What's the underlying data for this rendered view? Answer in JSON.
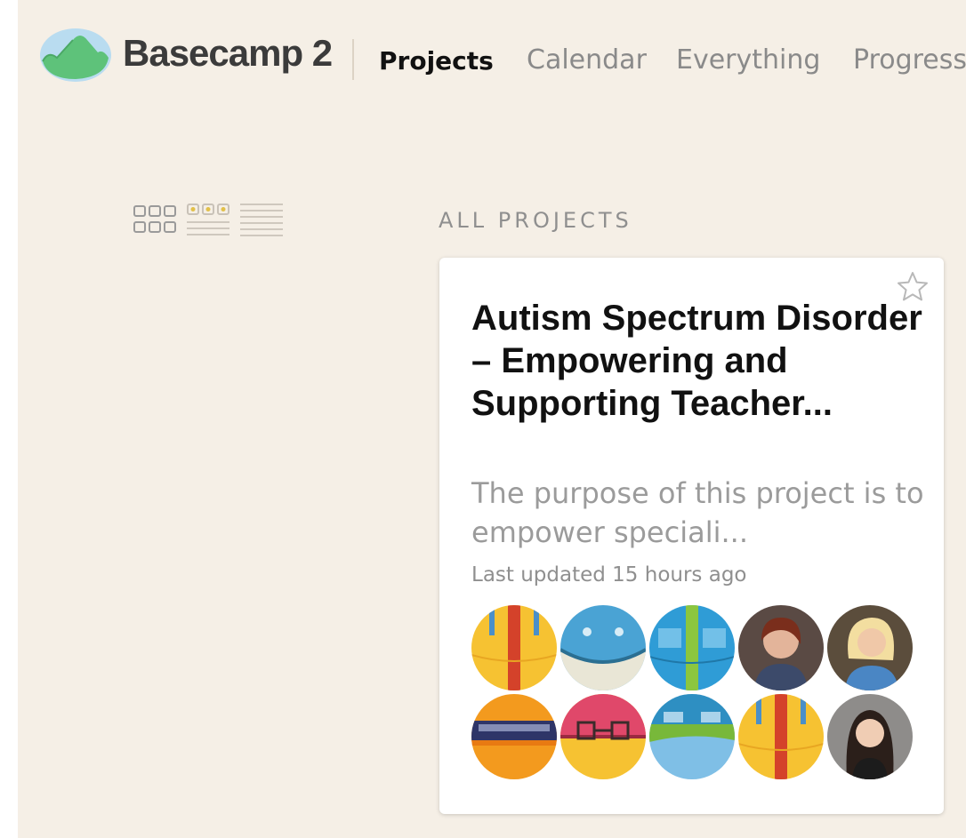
{
  "header": {
    "logo_text": "Basecamp 2",
    "nav": [
      {
        "label": "Projects",
        "active": true
      },
      {
        "label": "Calendar",
        "active": false
      },
      {
        "label": "Everything",
        "active": false
      },
      {
        "label": "Progress",
        "active": false
      }
    ]
  },
  "view_toggles": [
    "grid-view-icon",
    "card-list-view-icon",
    "list-view-icon"
  ],
  "section_label": "ALL PROJECTS",
  "project": {
    "title": "Autism Spectrum Disorder – Empowering and Supporting Teacher...",
    "description": "The purpose of this project is to empower speciali...",
    "last_updated": "Last updated 15 hours ago",
    "starred": false
  },
  "colors": {
    "background": "#f5efe6",
    "logo_green": "#5ec27a",
    "logo_blue": "#b9dcf0",
    "text_dark": "#111111",
    "text_muted": "#9b9b9b"
  }
}
